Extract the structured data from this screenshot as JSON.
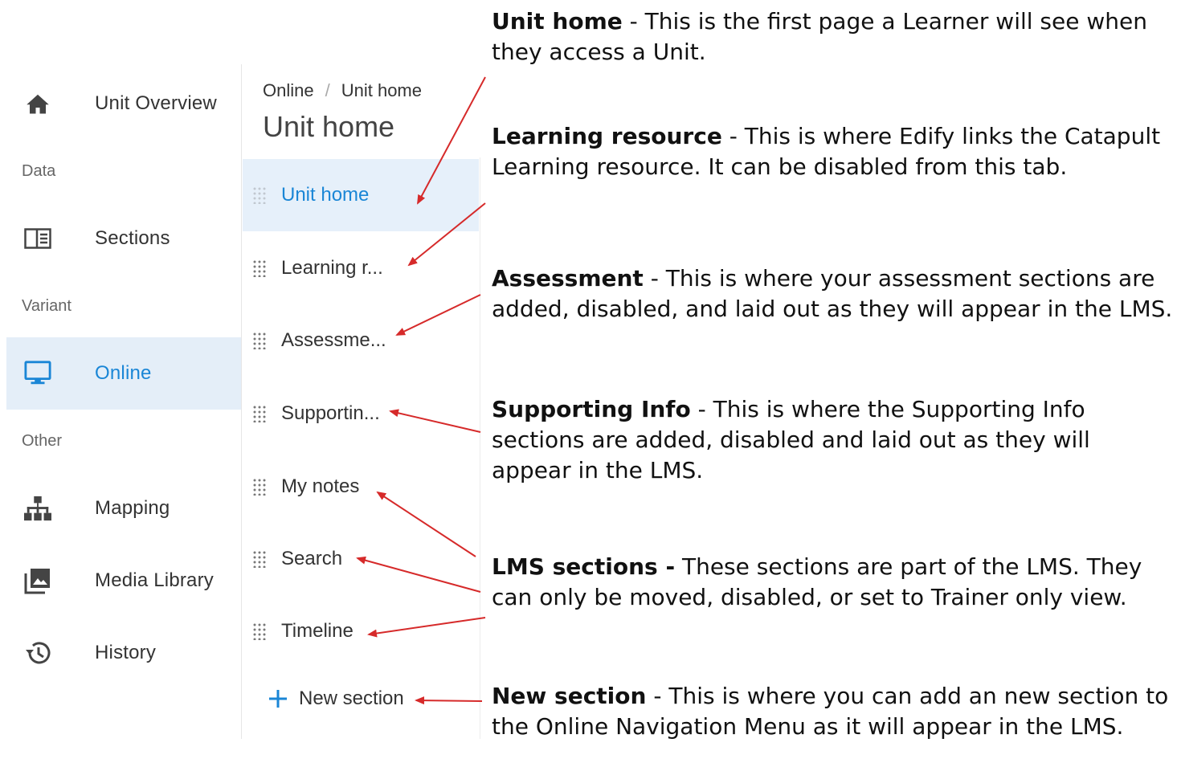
{
  "nav": {
    "unit_overview": "Unit Overview",
    "group_data": "Data",
    "sections": "Sections",
    "group_variant": "Variant",
    "online": "Online",
    "group_other": "Other",
    "mapping": "Mapping",
    "media_library": "Media Library",
    "history": "History"
  },
  "panel": {
    "breadcrumb_root": "Online",
    "breadcrumb_sep": "/",
    "breadcrumb_current": "Unit home",
    "title": "Unit home",
    "items": [
      {
        "label": "Unit home"
      },
      {
        "label": "Learning r..."
      },
      {
        "label": "Assessme..."
      },
      {
        "label": "Supportin..."
      },
      {
        "label": "My notes"
      },
      {
        "label": "Search"
      },
      {
        "label": "Timeline"
      }
    ],
    "new_section": "New section"
  },
  "annotations": [
    {
      "title": "Unit home",
      "text": " - This is the first page a Learner will see when they access a Unit."
    },
    {
      "title": "Learning resource",
      "text": " - This is where Edify links the Catapult Learning resource. It can be disabled from this tab."
    },
    {
      "title": "Assessment",
      "text": " - This is where your assessment sections are added, disabled, and laid out as they will appear in the LMS."
    },
    {
      "title": "Supporting Info",
      "text": " - This is where the Supporting Info sections are added, disabled and laid out as they will appear in the LMS."
    },
    {
      "title": "LMS sections -",
      "text": " These sections are part of the LMS. They can only be moved, disabled, or set to Trainer only view."
    },
    {
      "title": "New section",
      "text": " - This is where you can add an new section to the Online Navigation Menu as it will appear in the LMS."
    }
  ],
  "colors": {
    "accent": "#1a86d6",
    "active_bg": "#e4eef8",
    "arrow": "#d62a2a"
  }
}
